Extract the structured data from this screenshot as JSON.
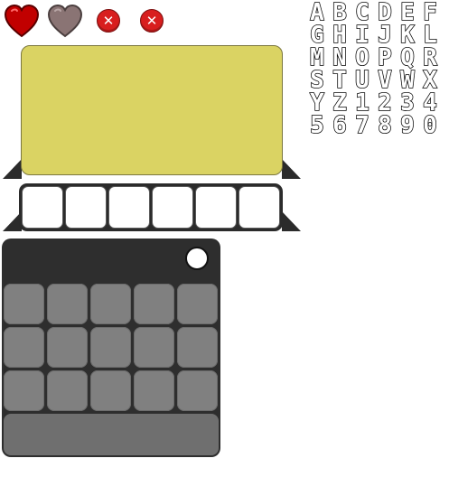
{
  "hud": {
    "hearts": [
      {
        "name": "heart-full-icon",
        "color": "#c10000"
      },
      {
        "name": "heart-empty-icon",
        "color": "#8a7474"
      }
    ],
    "close_buttons": [
      {
        "glyph": "✕",
        "color": "#d81e1e"
      },
      {
        "glyph": "✕",
        "color": "#d81e1e"
      }
    ]
  },
  "font_sheet": {
    "glyphs": [
      "A",
      "B",
      "C",
      "D",
      "E",
      "F",
      "G",
      "H",
      "I",
      "J",
      "K",
      "L",
      "M",
      "N",
      "O",
      "P",
      "Q",
      "R",
      "S",
      "T",
      "U",
      "V",
      "W",
      "X",
      "Y",
      "Z",
      "1",
      "2",
      "3",
      "4",
      "5",
      "6",
      "7",
      "8",
      "9",
      "0"
    ]
  },
  "dialog": {
    "screen_color": "#dad363",
    "frame_color": "#2b2b2b"
  },
  "slot_bar": {
    "slot_count": 6
  },
  "grid_panel": {
    "columns": 5,
    "rows": 3,
    "cell_color": "#808080",
    "panel_color": "#2e2e2e"
  }
}
